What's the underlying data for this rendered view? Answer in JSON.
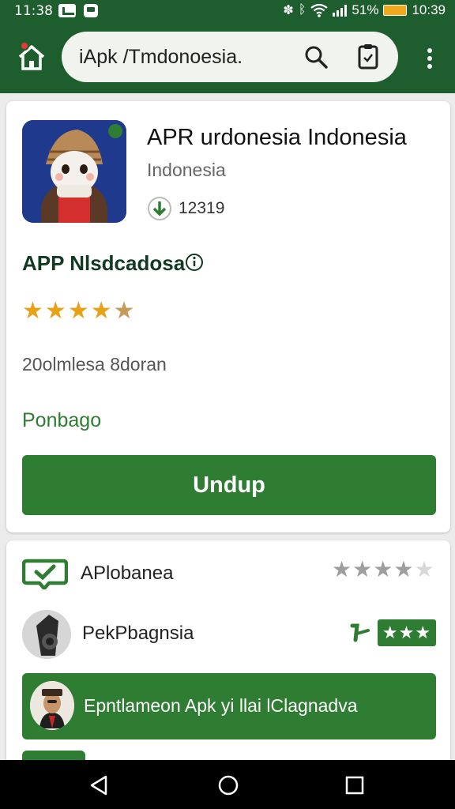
{
  "status_bar": {
    "time_left": "11:38",
    "battery_text": "51%",
    "time_right": "10:39",
    "icons": [
      "message-icon",
      "notification-icon",
      "vibrate-icon",
      "bluetooth-icon",
      "wifi-icon",
      "signal-icon",
      "battery-icon"
    ],
    "battery_color": "#f0a81c"
  },
  "toolbar": {
    "address_text": "iApk /Tmdonoesia.",
    "icons": [
      "home-icon",
      "search-icon",
      "clipboard-icon",
      "more-vert-icon"
    ]
  },
  "app": {
    "name": "APR urdonesia Indonesia",
    "developer": "Indonesia",
    "download_count": "12319",
    "section_title": "APP Nlsdcadosa",
    "rating_stars": 4.5,
    "downloads_text": "20olmlesa 8doran",
    "category": "Ponbago",
    "install_label": "Undup"
  },
  "list": {
    "row1": {
      "label": "APlobanea",
      "rating_stars": 4
    },
    "row2": {
      "label": "PekPbagnsia",
      "stars_badge": "★★★"
    },
    "banner": {
      "text": "Epntlameon Apk yi llai lClagnadva"
    }
  },
  "colors": {
    "brand_dark": "#1e5e2e",
    "accent": "#2e7d32",
    "star": "#e8a21a"
  },
  "nav": {
    "icons": [
      "back-icon",
      "home-circle-icon",
      "recents-icon"
    ]
  }
}
